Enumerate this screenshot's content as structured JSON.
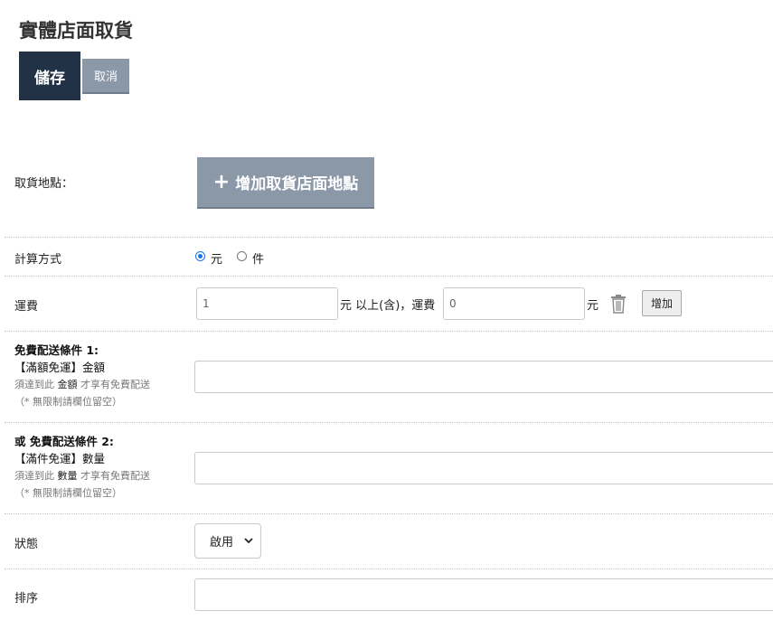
{
  "page": {
    "title": "實體店面取貨"
  },
  "toolbar": {
    "save_label": "儲存",
    "cancel_label": "取消"
  },
  "pickup": {
    "label": "取貨地點：",
    "add_button": "增加取貨店面地點",
    "add_icon": "plus-icon"
  },
  "calc": {
    "label": "計算方式",
    "options": [
      "元",
      "件"
    ],
    "selected": "元"
  },
  "shipping": {
    "label": "運費",
    "threshold_value": "1",
    "middle_text": "元 以上(含)，運費",
    "fee_value": "0",
    "unit_text": "元",
    "delete_icon": "trash-icon",
    "add_button": "增加"
  },
  "free1": {
    "heading": "免費配送條件 1:",
    "title": "【滿額免運】金額",
    "hint_pre": "須達到此 ",
    "hint_key": "金額",
    "hint_post": " 才享有免費配送",
    "note": "（* 無限制請欄位留空）",
    "value": ""
  },
  "free2": {
    "heading": "或 免費配送條件 2:",
    "title": "【滿件免運】數量",
    "hint_pre": "須達到此 ",
    "hint_key": "數量",
    "hint_post": " 才享有免費配送",
    "note": "（* 無限制請欄位留空）",
    "value": ""
  },
  "status": {
    "label": "狀態",
    "selected": "啟用"
  },
  "sort": {
    "label": "排序",
    "value": ""
  }
}
